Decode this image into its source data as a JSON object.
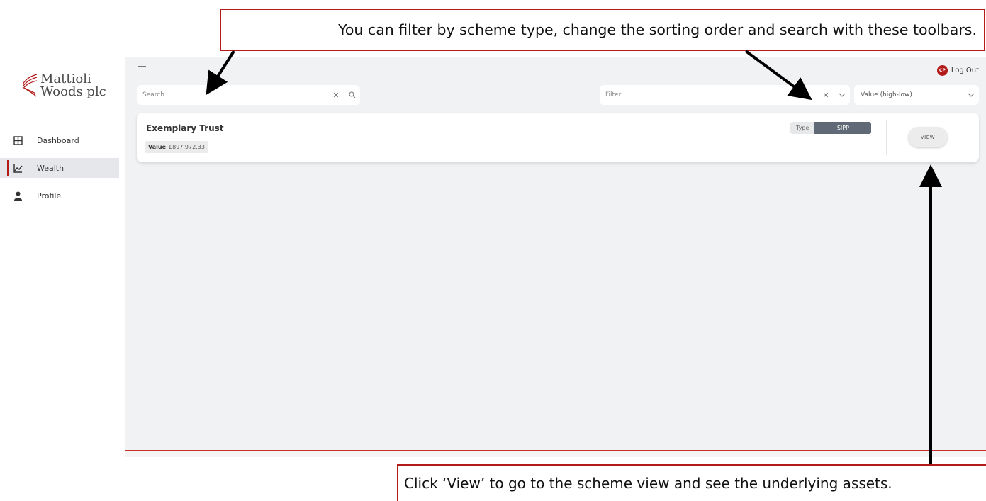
{
  "callouts": {
    "top": "You can filter by scheme type, change the sorting order and search with these toolbars.",
    "bottom": "Click ‘View’ to go to the scheme view and see the underlying assets."
  },
  "brand": {
    "line1": "Mattioli",
    "line2": "Woods plc"
  },
  "nav": [
    {
      "label": "Dashboard",
      "icon": "grid-icon",
      "active": false
    },
    {
      "label": "Wealth",
      "icon": "chart-line-icon",
      "active": true
    },
    {
      "label": "Profile",
      "icon": "user-icon",
      "active": false
    }
  ],
  "header": {
    "avatar_initials": "CP",
    "logout_label": "Log Out"
  },
  "toolbar": {
    "search_placeholder": "Search",
    "filter_placeholder": "Filter",
    "sort_value": "Value (high-low)"
  },
  "scheme": {
    "name": "Exemplary Trust",
    "value_label": "Value",
    "value": "£897,972.33",
    "type_label": "Type",
    "type_value": "SIPP",
    "view_label": "VIEW"
  },
  "colors": {
    "accent": "#b31b1b",
    "background": "#f1f2f4",
    "badge": "#5f6a76"
  }
}
